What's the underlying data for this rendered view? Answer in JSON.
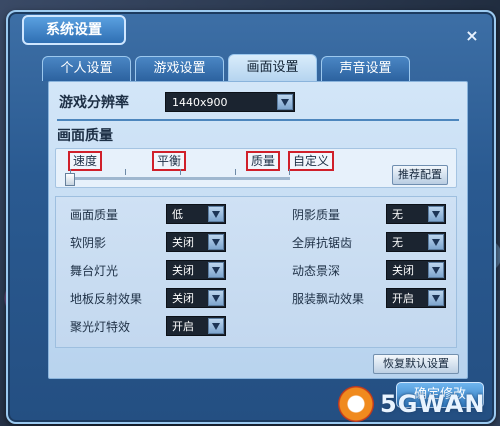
{
  "dialog": {
    "title": "系统设置",
    "close_glyph": "×"
  },
  "tabs": [
    {
      "label": "个人设置",
      "active": false
    },
    {
      "label": "游戏设置",
      "active": false
    },
    {
      "label": "画面设置",
      "active": true
    },
    {
      "label": "声音设置",
      "active": false
    }
  ],
  "display": {
    "resolution_label": "游戏分辨率",
    "resolution_value": "1440x900",
    "quality_section": "画面质量",
    "presets": [
      "速度",
      "平衡",
      "质量",
      "自定义"
    ],
    "recommended_button": "推荐配置"
  },
  "options": {
    "left": [
      {
        "label": "画面质量",
        "value": "低"
      },
      {
        "label": "软阴影",
        "value": "关闭"
      },
      {
        "label": "舞台灯光",
        "value": "关闭"
      },
      {
        "label": "地板反射效果",
        "value": "关闭"
      },
      {
        "label": "聚光灯特效",
        "value": "开启"
      }
    ],
    "right": [
      {
        "label": "阴影质量",
        "value": "无"
      },
      {
        "label": "全屏抗锯齿",
        "value": "无"
      },
      {
        "label": "动态景深",
        "value": "关闭"
      },
      {
        "label": "服装飘动效果",
        "value": "开启"
      }
    ]
  },
  "buttons": {
    "reset": "恢复默认设置",
    "confirm": "确定修改"
  },
  "watermark": {
    "text": "5GWAN"
  }
}
